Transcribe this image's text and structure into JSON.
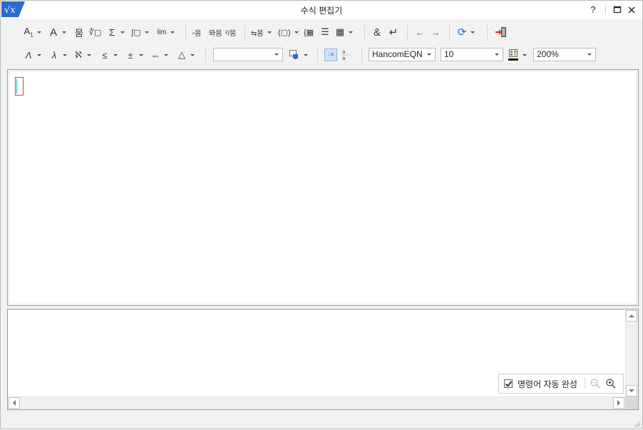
{
  "window": {
    "title": "수식 편집기",
    "app_icon_text": "√x"
  },
  "title_controls": {
    "help": "?",
    "maximize": "☐",
    "close": "✕"
  },
  "toolbar1": {
    "script_size": "A",
    "script_size_sub": "1",
    "accent": "A",
    "fraction": "뭄",
    "root": "∜▢",
    "sum": "Σ",
    "integral": "∫▢",
    "limit": "lim",
    "matrix_a": "▫뭄",
    "matrix_b": "뫄뭄",
    "matrix_c": "²/뭄",
    "arrow_matrix": "⇆뭄",
    "paren": "(▢)",
    "brace_matrix": "{▦",
    "rows": "☰",
    "grid": "▦",
    "ampersand": "&",
    "newline": "↵",
    "prev": "←",
    "next": "→",
    "convert": "⟳",
    "exit": "⇥"
  },
  "toolbar2": {
    "greek_upper": "Λ",
    "greek_lower": "λ",
    "hebrew": "ℵ",
    "relation": "≤",
    "operator": "±",
    "arrow": "⇔",
    "misc": "△",
    "command_input": "",
    "font": "HancomEQN",
    "font_size": "10",
    "zoom": "200%"
  },
  "autocomplete": {
    "label": "명령어 자동 완성",
    "checked": true
  },
  "colors": {
    "accent": "#2a6bd1",
    "cursor_border": "#e23b3b",
    "cursor_line": "#2bb09a"
  }
}
